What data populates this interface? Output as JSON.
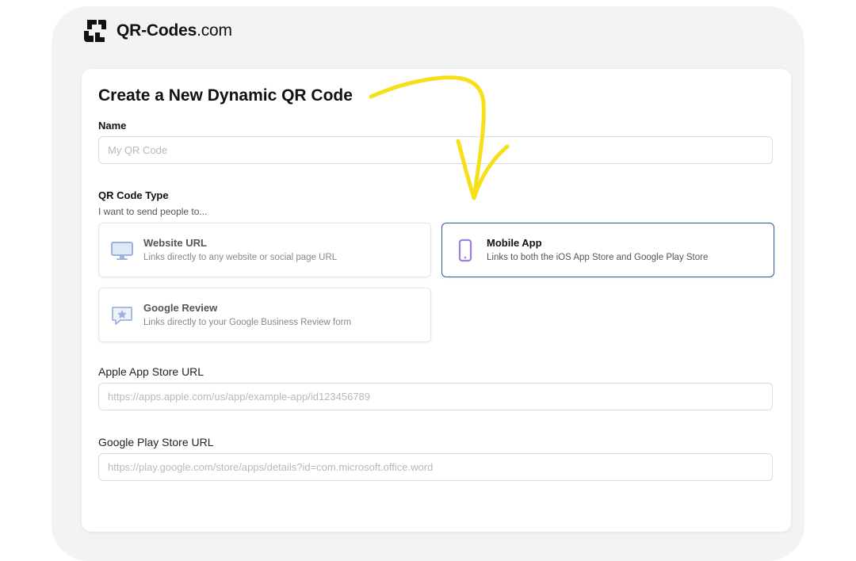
{
  "brand": {
    "name_bold": "QR-Codes",
    "name_light": ".com"
  },
  "form": {
    "title": "Create a New Dynamic QR Code",
    "name_label": "Name",
    "name_placeholder": "My QR Code",
    "type_label": "QR Code Type",
    "type_subtitle": "I want to send people to...",
    "options": [
      {
        "title": "Website URL",
        "desc": "Links directly to any website or social page URL",
        "icon": "monitor-icon",
        "selected": false
      },
      {
        "title": "Mobile App",
        "desc": "Links to both the iOS App Store and Google Play Store",
        "icon": "phone-icon",
        "selected": true
      },
      {
        "title": "Google Review",
        "desc": "Links directly to your Google Business Review form",
        "icon": "review-star-icon",
        "selected": false
      }
    ],
    "apple_label": "Apple App Store URL",
    "apple_placeholder": "https://apps.apple.com/us/app/example-app/id123456789",
    "google_label": "Google Play Store URL",
    "google_placeholder": "https://play.google.com/store/apps/details?id=com.microsoft.office.word"
  },
  "colors": {
    "selected_border": "#2f5aa8",
    "arrow": "#f5e01a",
    "icon_purple": "#9d7fe0",
    "icon_blue": "#9cb3e0"
  }
}
